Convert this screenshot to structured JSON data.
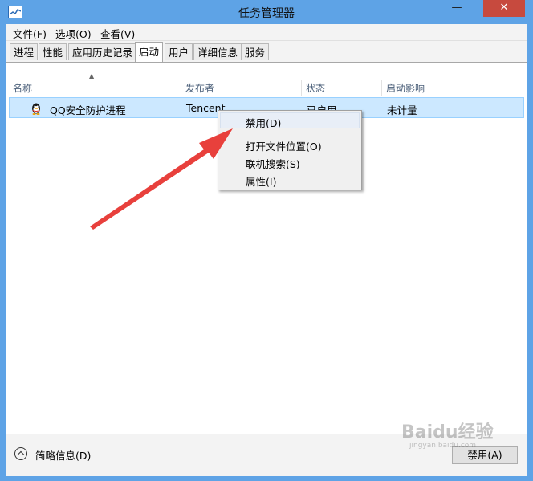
{
  "window": {
    "title": "任务管理器",
    "minimize_glyph": "—",
    "maximize_glyph": "□",
    "close_glyph": "✕"
  },
  "menubar": [
    {
      "label": "文件(F)"
    },
    {
      "label": "选项(O)"
    },
    {
      "label": "查看(V)"
    }
  ],
  "tabs": [
    {
      "label": "进程"
    },
    {
      "label": "性能"
    },
    {
      "label": "应用历史记录"
    },
    {
      "label": "启动",
      "active": true
    },
    {
      "label": "用户"
    },
    {
      "label": "详细信息"
    },
    {
      "label": "服务"
    }
  ],
  "table": {
    "columns": [
      "名称",
      "发布者",
      "状态",
      "启动影响"
    ],
    "rows": [
      {
        "name": "QQ安全防护进程",
        "publisher": "Tencent",
        "status": "已启用",
        "impact": "未计量",
        "icon": "qq-penguin-icon"
      }
    ]
  },
  "context_menu": {
    "items": [
      "禁用(D)",
      "打开文件位置(O)",
      "联机搜索(S)",
      "属性(I)"
    ]
  },
  "footer": {
    "summary_label": "简略信息(D)",
    "disable_button": "禁用(A)"
  },
  "watermark": {
    "text": "Baidu经验",
    "sub": "jingyan.baidu.com"
  },
  "colors": {
    "titlebar": "#5ea3e6",
    "selection": "#cce8ff",
    "arrow": "#e8403c",
    "close": "#c74a3e"
  }
}
